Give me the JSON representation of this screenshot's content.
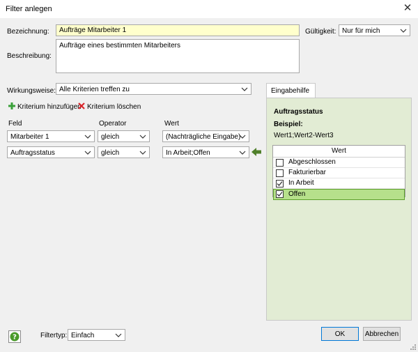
{
  "window": {
    "title": "Filter anlegen"
  },
  "form": {
    "bezeichnung_label": "Bezeichnung:",
    "bezeichnung_value": "Aufträge Mitarbeiter 1",
    "gueltigkeit_label": "Gültigkeit:",
    "gueltigkeit_value": "Nur für mich",
    "beschreibung_label": "Beschreibung:",
    "beschreibung_value": "Aufträge eines bestimmten Mitarbeiters",
    "wirkungsweise_label": "Wirkungsweise:",
    "wirkungsweise_value": "Alle Kriterien treffen zu"
  },
  "actions": {
    "add_label": "Kriterium hinzufügen",
    "delete_label": "Kriterium löschen"
  },
  "criteria": {
    "headers": {
      "feld": "Feld",
      "operator": "Operator",
      "wert": "Wert"
    },
    "rows": [
      {
        "feld": "Mitarbeiter 1",
        "operator": "gleich",
        "wert": "(Nachträgliche Eingabe)"
      },
      {
        "feld": "Auftragsstatus",
        "operator": "gleich",
        "wert": "In Arbeit;Offen"
      }
    ]
  },
  "eingabehilfe": {
    "tab_label": "Eingabehilfe",
    "title": "Auftragsstatus",
    "beispiel_label": "Beispiel:",
    "beispiel_value": "Wert1;Wert2-Wert3",
    "grid_header": "Wert",
    "items": [
      {
        "label": "Abgeschlossen",
        "checked": false
      },
      {
        "label": "Fakturierbar",
        "checked": false
      },
      {
        "label": "In Arbeit",
        "checked": true
      },
      {
        "label": "Offen",
        "checked": true
      }
    ]
  },
  "footer": {
    "filtertyp_label": "Filtertyp:",
    "filtertyp_value": "Einfach",
    "ok_label": "OK",
    "cancel_label": "Abbrechen"
  },
  "colors": {
    "accent_green": "#b6e08b",
    "panel_bg": "#e2ecd4",
    "add_green": "#3aa13a",
    "delete_red": "#d9262c"
  }
}
